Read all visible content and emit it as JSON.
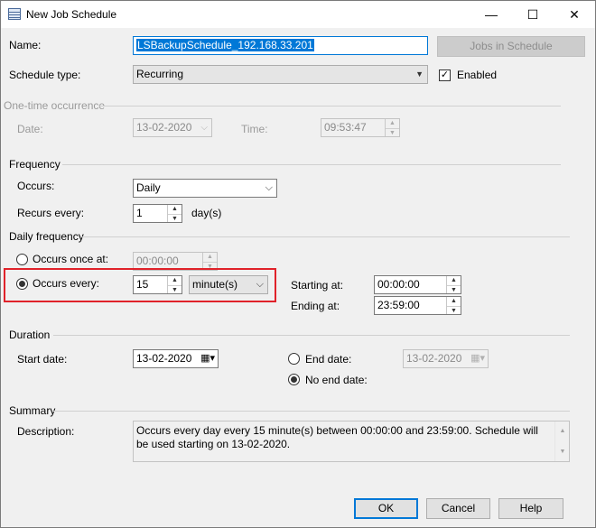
{
  "window": {
    "title": "New Job Schedule",
    "minimize_glyph": "—",
    "maximize_glyph": "☐",
    "close_glyph": "✕"
  },
  "name": {
    "label": "Name:",
    "value": "LSBackupSchedule_192.168.33.201"
  },
  "jobs_button": "Jobs in Schedule",
  "schedule_type": {
    "label": "Schedule type:",
    "value": "Recurring",
    "enabled_label": "Enabled",
    "enabled_checked": true
  },
  "one_time": {
    "heading": "One-time occurrence",
    "date_label": "Date:",
    "date_value": "13-02-2020",
    "time_label": "Time:",
    "time_value": "09:53:47"
  },
  "frequency": {
    "heading": "Frequency",
    "occurs_label": "Occurs:",
    "occurs_value": "Daily",
    "recurs_label": "Recurs every:",
    "recurs_value": "1",
    "recurs_unit": "day(s)"
  },
  "daily_frequency": {
    "heading": "Daily frequency",
    "once_label": "Occurs once at:",
    "once_value": "00:00:00",
    "once_selected": false,
    "every_label": "Occurs every:",
    "every_value": "15",
    "every_unit": "minute(s)",
    "every_selected": true,
    "starting_label": "Starting at:",
    "starting_value": "00:00:00",
    "ending_label": "Ending at:",
    "ending_value": "23:59:00"
  },
  "duration": {
    "heading": "Duration",
    "start_label": "Start date:",
    "start_value": "13-02-2020",
    "end_label": "End date:",
    "end_value": "13-02-2020",
    "end_selected": false,
    "no_end_label": "No end date:",
    "no_end_selected": true
  },
  "summary": {
    "heading": "Summary",
    "description_label": "Description:",
    "description_text": "Occurs every day every 15 minute(s) between 00:00:00 and 23:59:00. Schedule will be used starting on 13-02-2020."
  },
  "buttons": {
    "ok": "OK",
    "cancel": "Cancel",
    "help": "Help"
  },
  "colors": {
    "accent": "#0078d7",
    "highlight": "#e0222a"
  }
}
